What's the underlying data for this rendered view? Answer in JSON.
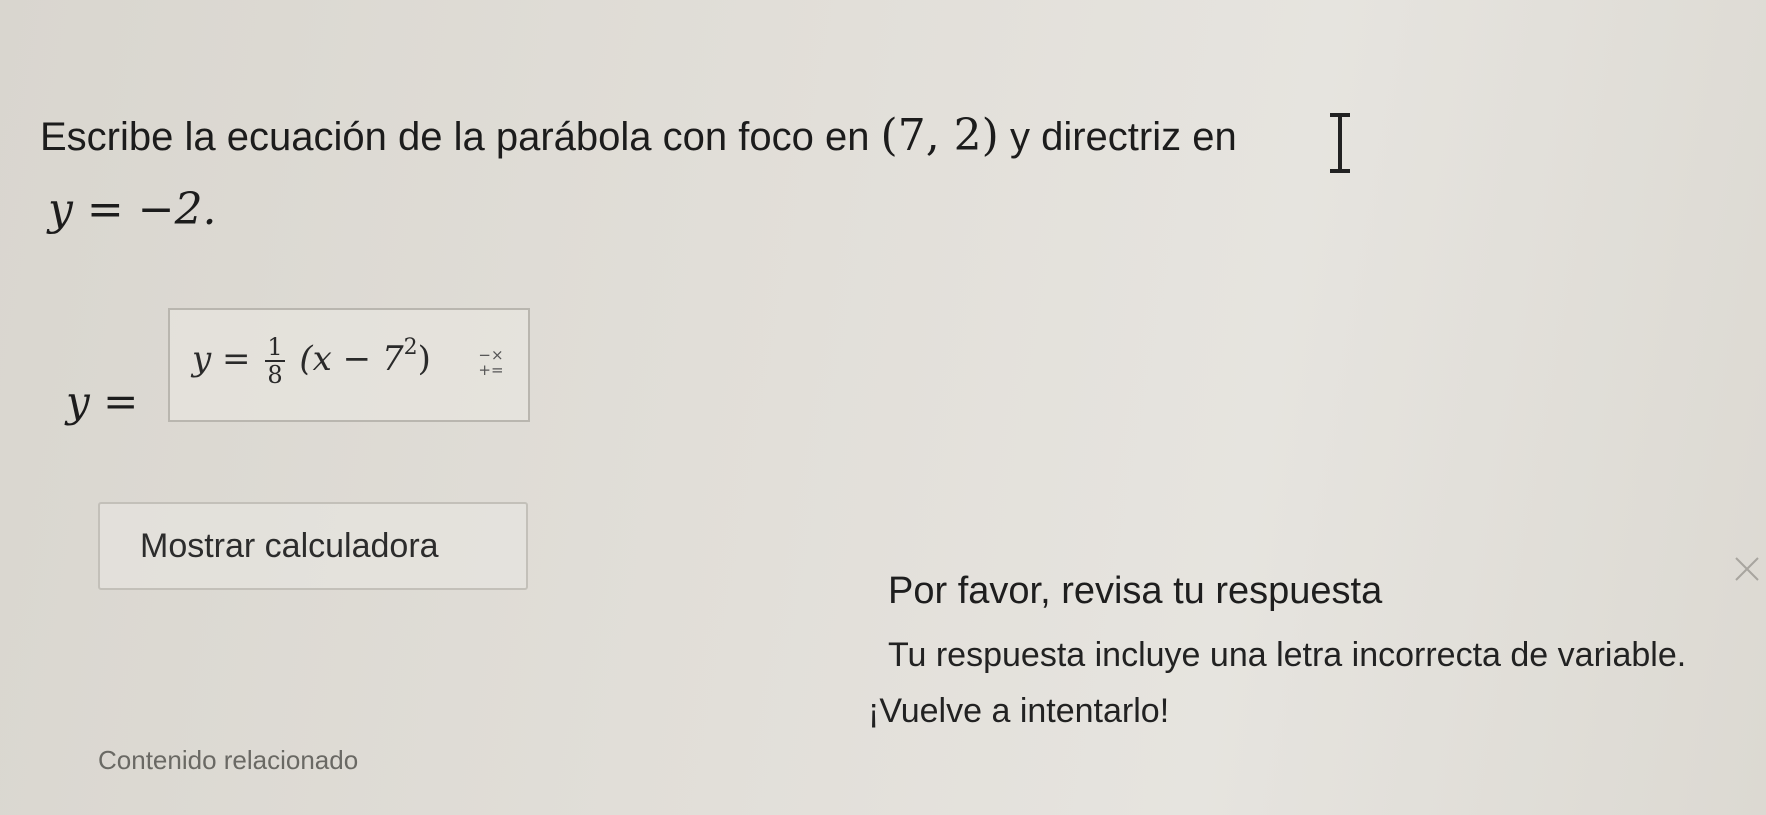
{
  "question": {
    "text_before": "Escribe la ecuación de la parábola con foco en ",
    "focus": "(7, 2)",
    "text_after": " y directriz en",
    "directrix": "y = −2."
  },
  "answer": {
    "prefix": "y =",
    "expr_lhs": "y =",
    "frac_num": "1",
    "frac_den": "8",
    "expr_body": "(x − 7",
    "expr_exp": "2",
    "expr_close": ")",
    "keypad_top": "−×",
    "keypad_bottom": "+="
  },
  "calculator": {
    "label": "Mostrar calculadora"
  },
  "feedback": {
    "title": "Por favor, revisa tu respuesta",
    "message": "Tu respuesta incluye una letra incorrecta de variable.",
    "retry": "¡Vuelve a intentarlo!"
  },
  "related": {
    "label": "Contenido relacionado"
  },
  "icons": {
    "cursor": "text-cursor-icon",
    "keypad": "math-keypad-icon",
    "close": "close-icon"
  }
}
